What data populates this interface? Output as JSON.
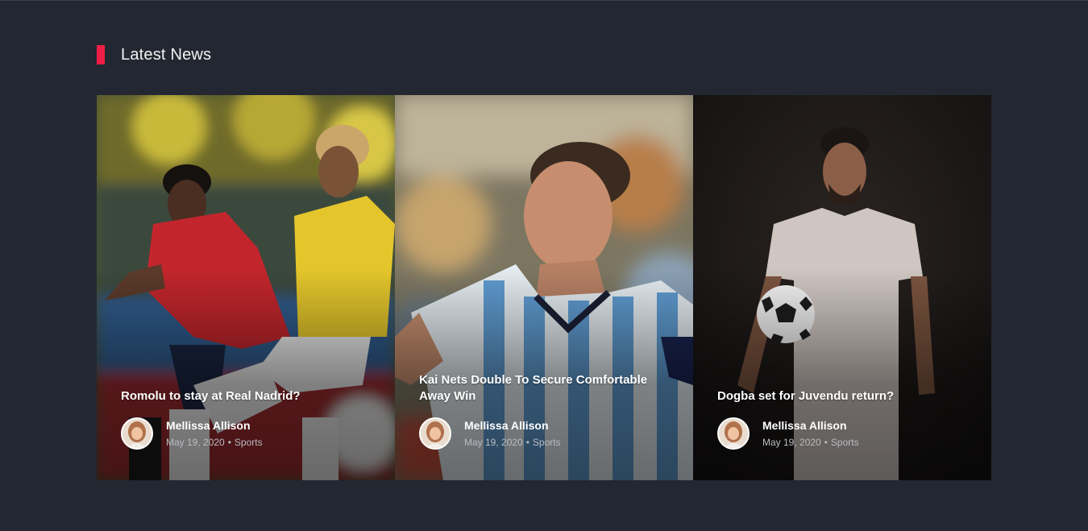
{
  "section": {
    "title": "Latest News"
  },
  "colors": {
    "accent": "#ee1e46",
    "background": "#232731"
  },
  "cards": [
    {
      "title": "Romolu to stay at Real Nadrid?",
      "author": "Mellissa Allison",
      "date": "May 19, 2020",
      "separator": "•",
      "category": "Sports",
      "image": "two-football-players-tackle-photo"
    },
    {
      "title": "Kai Nets Double To Secure Comfortable Away Win",
      "author": "Mellissa Allison",
      "date": "May 19, 2020",
      "separator": "•",
      "category": "Sports",
      "image": "striped-jersey-player-photo"
    },
    {
      "title": "Dogba set for Juvendu return?",
      "author": "Mellissa Allison",
      "date": "May 19, 2020",
      "separator": "•",
      "category": "Sports",
      "image": "player-holding-ball-photo"
    }
  ]
}
